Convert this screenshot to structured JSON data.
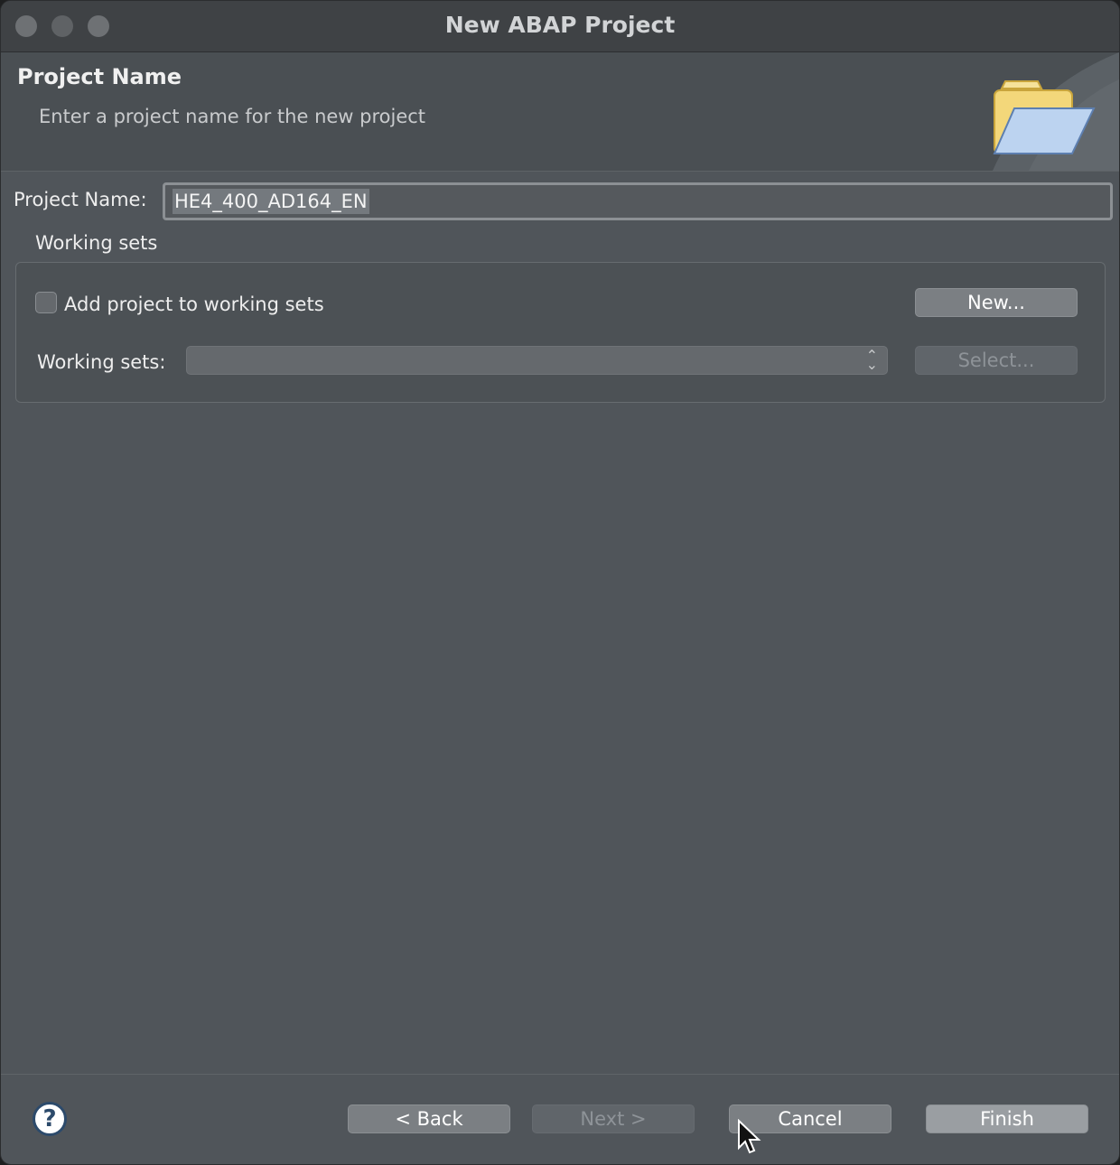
{
  "window": {
    "title": "New ABAP Project"
  },
  "header": {
    "title": "Project Name",
    "subtitle": "Enter a project name for the new project",
    "icon": "folder-open-icon"
  },
  "form": {
    "project_name_label": "Project Name:",
    "project_name_value": "HE4_400_AD164_EN",
    "working_sets_heading": "Working sets",
    "add_to_working_sets_label": "Add project to working sets",
    "add_to_working_sets_checked": false,
    "new_button": "New...",
    "working_sets_label": "Working sets:",
    "working_sets_selected": "",
    "select_button": "Select..."
  },
  "footer": {
    "back_button": "< Back",
    "next_button": "Next >",
    "cancel_button": "Cancel",
    "finish_button": "Finish",
    "help_icon": "help-icon",
    "help_glyph": "?"
  }
}
